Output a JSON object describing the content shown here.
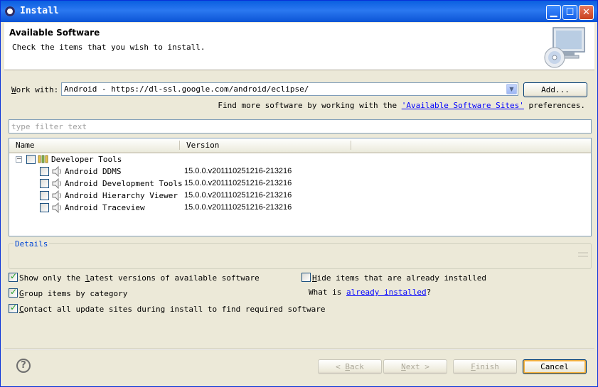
{
  "window": {
    "title": "Install"
  },
  "header": {
    "title": "Available Software",
    "subtitle": "Check the items that you wish to install."
  },
  "work_with": {
    "label_pre": "",
    "label_mnemonic": "W",
    "label_post": "ork with:",
    "value": "Android - https://dl-ssl.google.com/android/eclipse/",
    "add_label": "Add..."
  },
  "find_more": {
    "prefix": "Find more software by working with the",
    "link": "'Available Software Sites'",
    "suffix": "preferences."
  },
  "filter": {
    "placeholder": "type filter text"
  },
  "table": {
    "columns": [
      "Name",
      "Version"
    ],
    "category": {
      "name": "Developer Tools",
      "checked": false
    },
    "items": [
      {
        "name": "Android DDMS",
        "version": "15.0.0.v201110251216-213216",
        "checked": false
      },
      {
        "name": "Android Development Tools",
        "version": "15.0.0.v201110251216-213216",
        "checked": false
      },
      {
        "name": "Android Hierarchy Viewer",
        "version": "15.0.0.v201110251216-213216",
        "checked": false
      },
      {
        "name": "Android Traceview",
        "version": "15.0.0.v201110251216-213216",
        "checked": false
      }
    ]
  },
  "details": {
    "legend": "Details"
  },
  "options": {
    "latest": {
      "pre": "Show only the ",
      "mn": "l",
      "post": "atest versions of available software",
      "checked": true
    },
    "group": {
      "pre": "",
      "mn": "G",
      "post": "roup items by category",
      "checked": true
    },
    "contact": {
      "pre": "",
      "mn": "C",
      "post": "ontact all update sites during install to find required software",
      "checked": true
    },
    "hide": {
      "pre": "",
      "mn": "H",
      "post": "ide items that are already installed",
      "checked": false
    },
    "what_is": {
      "prefix": "What is",
      "link": "already installed",
      "suffix": "?"
    }
  },
  "buttons": {
    "back": {
      "pre": "< ",
      "mn": "B",
      "post": "ack"
    },
    "next": {
      "pre": "",
      "mn": "N",
      "post": "ext >"
    },
    "finish": {
      "pre": "",
      "mn": "F",
      "post": "inish"
    },
    "cancel": "Cancel"
  },
  "colors": {
    "titlebar": "#0a5fe0",
    "link": "#0000ff",
    "accent_check": "#21a121",
    "dialog_bg": "#ece9d8"
  }
}
